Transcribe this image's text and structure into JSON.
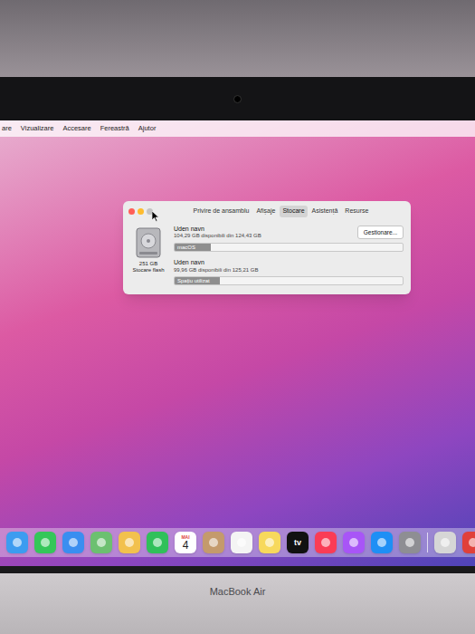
{
  "menu_bar": {
    "items": [
      "are",
      "Vizualizare",
      "Accesare",
      "Fereastră",
      "Ajutor"
    ]
  },
  "window": {
    "controls": [
      {
        "color": "#ff5f57"
      },
      {
        "color": "#febc2e"
      },
      {
        "color": "#c4c4c4"
      }
    ],
    "tabs": [
      {
        "label": "Privire de ansamblu",
        "selected": false
      },
      {
        "label": "Afișaje",
        "selected": false
      },
      {
        "label": "Stocare",
        "selected": true
      },
      {
        "label": "Asistență",
        "selected": false
      },
      {
        "label": "Resurse",
        "selected": false
      }
    ],
    "disk": {
      "size": "251 GB",
      "type": "Stocare flash"
    },
    "manage_button": "Gestionare...",
    "volumes": [
      {
        "name": "Uden navn",
        "info": "104,29 GB disponibili din 124,43 GB",
        "bar_label": "macOS",
        "level": 0.16
      },
      {
        "name": "Uden navn",
        "info": "99,96 GB disponibili din 125,21 GB",
        "bar_label": "Spațiu utilizat",
        "level": 0.2
      }
    ]
  },
  "dock": {
    "apps": [
      {
        "color": "#3c9cf0",
        "texts": []
      },
      {
        "color": "#34c759",
        "texts": []
      },
      {
        "color": "#3a8ef0",
        "texts": []
      },
      {
        "color": "#6cc070",
        "texts": []
      },
      {
        "color": "#f2c14e",
        "texts": []
      },
      {
        "color": "#30c05a",
        "texts": []
      },
      {
        "color": "#ffffff",
        "texts": [
          "MAI",
          "4"
        ]
      },
      {
        "color": "#c49a6c",
        "texts": []
      },
      {
        "color": "#f4f4f4",
        "texts": []
      },
      {
        "color": "#f7d95c",
        "texts": []
      },
      {
        "color": "#111111",
        "texts": [
          "tv"
        ]
      },
      {
        "color": "#fa3c55",
        "texts": []
      },
      {
        "color": "#a855f7",
        "texts": []
      },
      {
        "color": "#1e8ff5",
        "texts": []
      },
      {
        "color": "#8e8e93",
        "texts": []
      }
    ],
    "docs": [
      {
        "color": "#d6d6d6",
        "texts": []
      },
      {
        "color": "#e0403a",
        "texts": []
      }
    ]
  },
  "device_label": "MacBook Air"
}
